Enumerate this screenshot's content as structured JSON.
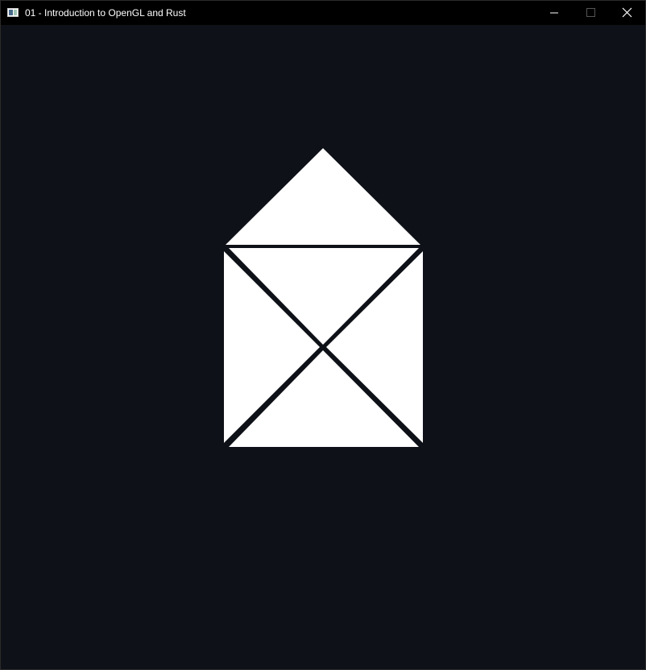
{
  "window": {
    "title": "01 - Introduction to OpenGL and Rust",
    "icon": "app-window-icon"
  },
  "controls": {
    "minimize": "minimize-icon",
    "maximize": "maximize-icon",
    "close": "close-icon"
  },
  "colors": {
    "background": "#0e1117",
    "titlebar": "#000000",
    "shape_fill": "#ffffff"
  },
  "scene": {
    "shape": "house"
  }
}
